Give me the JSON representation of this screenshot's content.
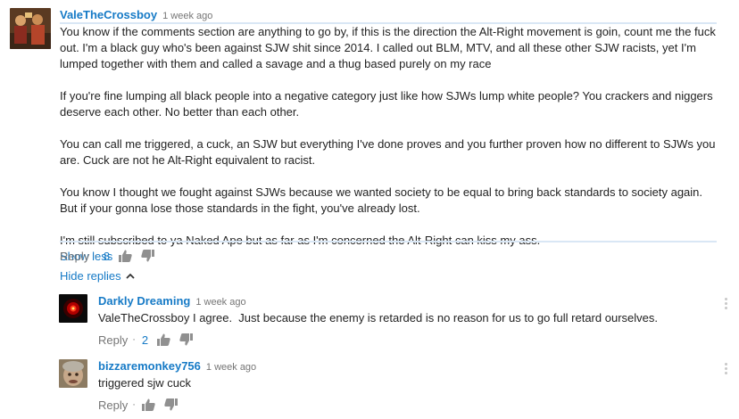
{
  "comment": {
    "author": "ValeTheCrossboy",
    "time": "1 week ago",
    "paragraphs": [
      "You know if the comments section are anything to go by, if this is the direction the Alt-Right movement is goin, count me the fuck out. I'm a black guy who's been against SJW shit since 2014. I called out BLM, MTV, and all these other SJW racists, yet I'm lumped together with them and called a savage and a thug based purely on my race",
      "If you're fine lumping all black people into a negative category just like how SJWs lump white people? You crackers and niggers deserve each other. No better than each other.",
      "You can call me triggered, a cuck, an SJW but everything I've done proves and you further proven how no different to SJWs you are. Cuck are not he Alt-Right equivalent to racist.",
      "You know I thought we fought against SJWs because we wanted society to be equal to bring back standards to society again. But if your gonna lose those standards in the fight, you've already lost.",
      "I'm still subscribed to ya Naked Ape but as far as I'm concerned the Alt-Right can kiss my ass."
    ],
    "show_less": "Show less",
    "reply_label": "Reply",
    "dot": "·",
    "likes": "8",
    "hide_replies": "Hide replies"
  },
  "replies": [
    {
      "author": "Darkly Dreaming",
      "time": "1 week ago",
      "text": "ValeTheCrossboy I agree.  Just because the enemy is retarded is no reason for us to go full retard ourselves.",
      "reply_label": "Reply",
      "dot": "·",
      "likes": "2"
    },
    {
      "author": "bizzaremonkey756",
      "time": "1 week ago",
      "text": "triggered sjw cuck",
      "reply_label": "Reply",
      "dot": "·",
      "likes": ""
    }
  ],
  "colors": {
    "link": "#167ac6",
    "muted": "#767676",
    "rule": "#d9e7f5"
  },
  "icons": [
    "thumbs-up-icon",
    "thumbs-down-icon",
    "chevron-up-icon",
    "more-vert-icon"
  ]
}
